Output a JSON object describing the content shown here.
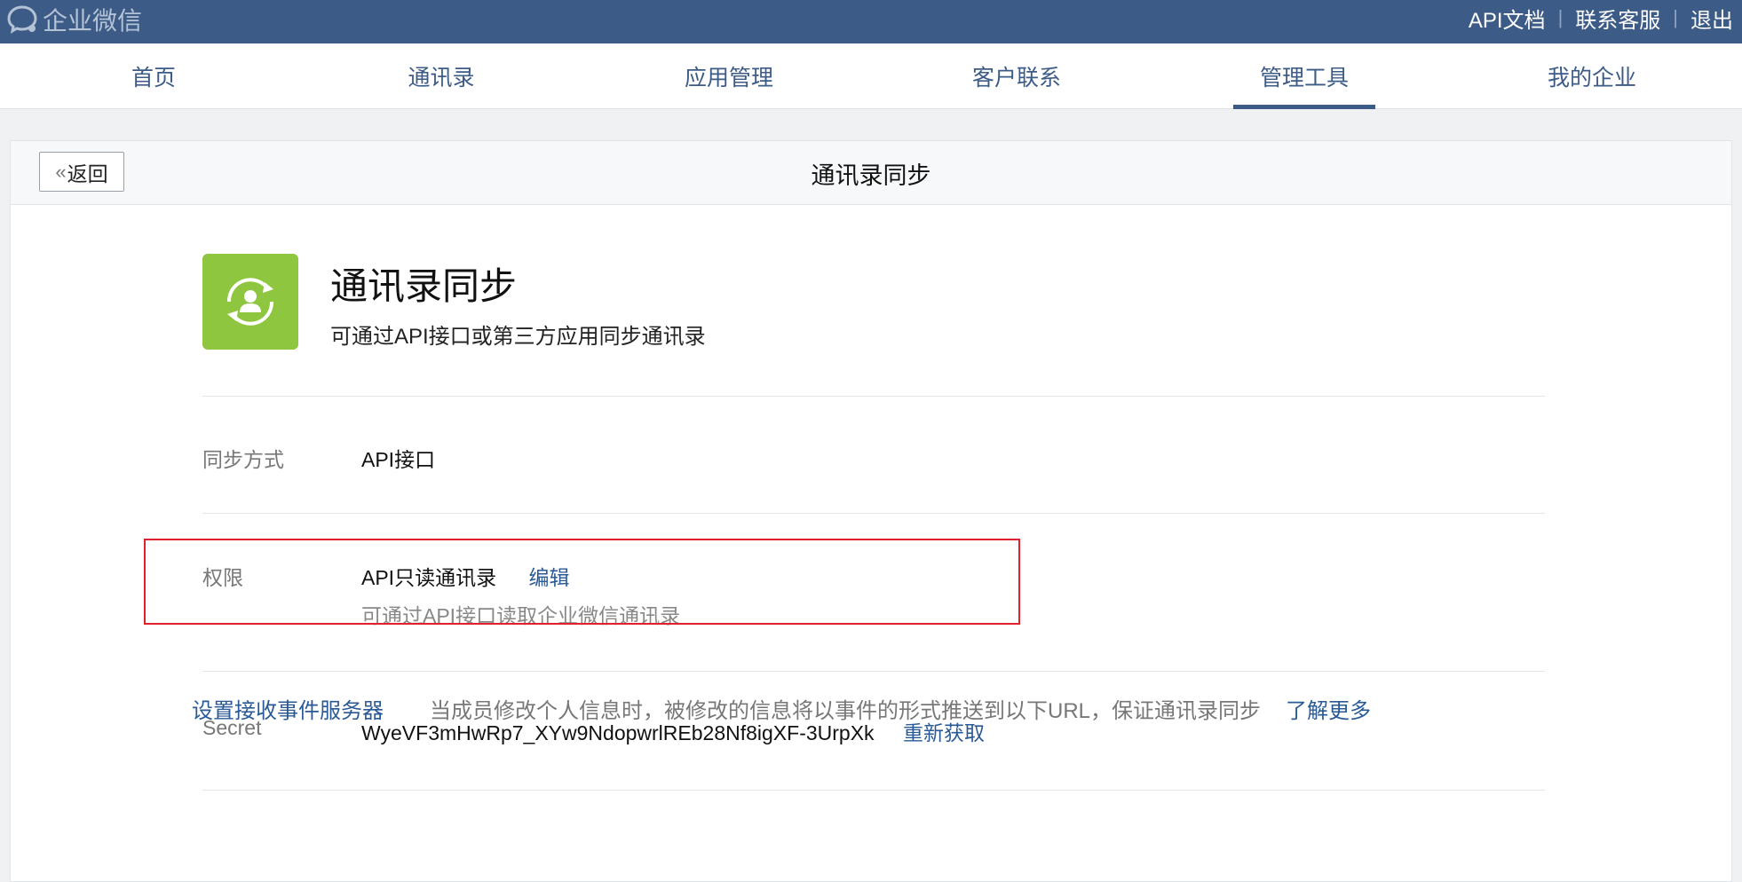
{
  "topbar": {
    "brand": "企业微信",
    "links": [
      "API文档",
      "联系客服",
      "退出"
    ]
  },
  "nav": {
    "items": [
      {
        "label": "首页"
      },
      {
        "label": "通讯录"
      },
      {
        "label": "应用管理"
      },
      {
        "label": "客户联系"
      },
      {
        "label": "管理工具"
      },
      {
        "label": "我的企业"
      }
    ],
    "active": "管理工具"
  },
  "card": {
    "back_label": "返回",
    "title": "通讯录同步"
  },
  "app": {
    "name": "通讯录同步",
    "desc": "可通过API接口或第三方应用同步通讯录",
    "icon": "contact-sync-icon",
    "icon_color": "#8fc63f"
  },
  "sync_method": {
    "label": "同步方式",
    "value": "API接口"
  },
  "permission": {
    "label": "权限",
    "value": "API只读通讯录",
    "edit_label": "编辑",
    "desc": "可通过API接口读取企业微信通讯录"
  },
  "secret": {
    "label": "Secret",
    "value": "WyeVF3mHwRp7_XYw9NdopwrlREb28Nf8igXF-3UrpXk",
    "refresh_label": "重新获取"
  },
  "event_server": {
    "link": "设置接收事件服务器",
    "desc": "当成员修改个人信息时，被修改的信息将以事件的形式推送到以下URL，保证通讯录同步",
    "more": "了解更多"
  },
  "colors": {
    "topbar": "#3c5b86",
    "link": "#2a5a96",
    "highlight": "#e0202d"
  }
}
